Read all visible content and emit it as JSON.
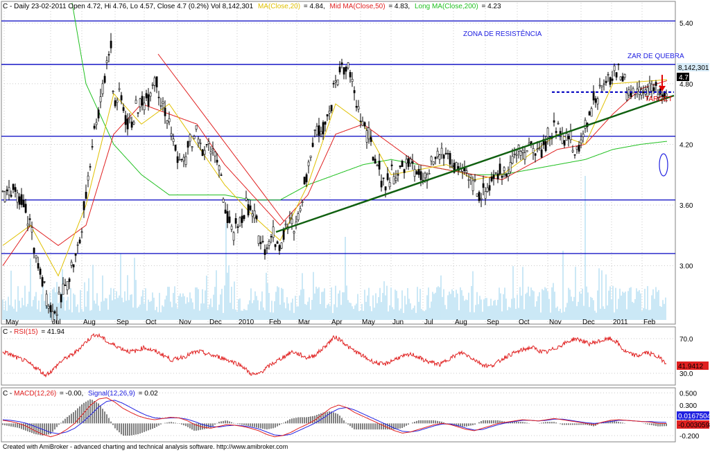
{
  "chart_data": [
    {
      "type": "candlestick",
      "header": {
        "prefix": "C - Daily 23-02-2011 Open 4.72, Hi 4.76, Lo 4.57, Close 4.7 (0.2%) Vol 8,142,301",
        "short_ma": "MA(Close,20)",
        "short_ma_value": "= 4.84,",
        "mid_ma": "Mid MA(Close,50)",
        "mid_ma_value": "= 4.83,",
        "long_ma": "Long MA(Close,200)",
        "long_ma_value": "= 4.23"
      },
      "x_labels": [
        "May",
        "Jul",
        "Aug",
        "Sep",
        "Oct",
        "Nov",
        "Dec",
        "2010",
        "Feb",
        "Mar",
        "Apr",
        "May",
        "Jun",
        "Jul",
        "Aug",
        "Sep",
        "Oct",
        "Nov",
        "Dec",
        "2011",
        "Feb"
      ],
      "y_ticks": [
        3.0,
        3.6,
        4.2,
        4.8,
        5.4
      ],
      "y_tick_labels": [
        "3.00",
        "3.60",
        "4.20",
        "4.80",
        "5.40"
      ],
      "ylim": [
        2.45,
        5.6
      ],
      "horizontal_levels": [
        5.42,
        4.99,
        4.28,
        3.65,
        3.12
      ],
      "price_path": [
        [
          0,
          3.7
        ],
        [
          10,
          3.8
        ],
        [
          20,
          3.65
        ],
        [
          30,
          3.6
        ],
        [
          40,
          3.4
        ],
        [
          50,
          3.0
        ],
        [
          60,
          2.8
        ],
        [
          70,
          2.55
        ],
        [
          80,
          2.6
        ],
        [
          90,
          2.8
        ],
        [
          100,
          3.0
        ],
        [
          110,
          3.2
        ],
        [
          120,
          3.7
        ],
        [
          130,
          4.3
        ],
        [
          140,
          4.6
        ],
        [
          150,
          5.0
        ],
        [
          155,
          5.3
        ],
        [
          160,
          4.6
        ],
        [
          170,
          4.7
        ],
        [
          180,
          4.4
        ],
        [
          190,
          4.5
        ],
        [
          200,
          4.6
        ],
        [
          210,
          4.7
        ],
        [
          220,
          4.9
        ],
        [
          230,
          4.6
        ],
        [
          240,
          4.4
        ],
        [
          250,
          4.1
        ],
        [
          260,
          4.0
        ],
        [
          270,
          4.2
        ],
        [
          280,
          4.3
        ],
        [
          290,
          4.1
        ],
        [
          300,
          4.2
        ],
        [
          310,
          4.0
        ],
        [
          320,
          3.6
        ],
        [
          330,
          3.3
        ],
        [
          340,
          3.4
        ],
        [
          350,
          3.6
        ],
        [
          360,
          3.5
        ],
        [
          370,
          3.3
        ],
        [
          380,
          3.2
        ],
        [
          390,
          3.3
        ],
        [
          400,
          3.2
        ],
        [
          410,
          3.4
        ],
        [
          420,
          3.4
        ],
        [
          430,
          3.6
        ],
        [
          440,
          4.0
        ],
        [
          450,
          4.3
        ],
        [
          460,
          4.4
        ],
        [
          470,
          4.5
        ],
        [
          480,
          4.8
        ],
        [
          490,
          5.0
        ],
        [
          500,
          4.9
        ],
        [
          510,
          4.6
        ],
        [
          520,
          4.4
        ],
        [
          530,
          4.2
        ],
        [
          540,
          4.0
        ],
        [
          550,
          3.8
        ],
        [
          560,
          3.9
        ],
        [
          570,
          3.9
        ],
        [
          580,
          4.0
        ],
        [
          590,
          4.0
        ],
        [
          600,
          3.9
        ],
        [
          610,
          3.8
        ],
        [
          620,
          4.0
        ],
        [
          630,
          4.1
        ],
        [
          640,
          4.1
        ],
        [
          650,
          4.0
        ],
        [
          660,
          3.9
        ],
        [
          670,
          3.9
        ],
        [
          680,
          3.8
        ],
        [
          690,
          3.7
        ],
        [
          700,
          3.8
        ],
        [
          710,
          3.9
        ],
        [
          720,
          3.9
        ],
        [
          730,
          4.0
        ],
        [
          740,
          4.1
        ],
        [
          750,
          4.1
        ],
        [
          760,
          4.2
        ],
        [
          770,
          4.1
        ],
        [
          780,
          4.2
        ],
        [
          790,
          4.3
        ],
        [
          800,
          4.4
        ],
        [
          810,
          4.3
        ],
        [
          820,
          4.2
        ],
        [
          830,
          4.1
        ],
        [
          840,
          4.4
        ],
        [
          850,
          4.6
        ],
        [
          860,
          4.7
        ],
        [
          870,
          4.8
        ],
        [
          880,
          4.9
        ],
        [
          890,
          4.95
        ],
        [
          900,
          4.75
        ],
        [
          910,
          4.72
        ],
        [
          920,
          4.74
        ],
        [
          930,
          4.76
        ],
        [
          940,
          4.73
        ],
        [
          950,
          4.7
        ],
        [
          958,
          4.7
        ]
      ],
      "short_ma_path": [
        [
          0,
          3.2
        ],
        [
          40,
          3.4
        ],
        [
          80,
          2.9
        ],
        [
          120,
          3.6
        ],
        [
          160,
          4.7
        ],
        [
          200,
          4.4
        ],
        [
          240,
          4.6
        ],
        [
          280,
          4.2
        ],
        [
          320,
          3.8
        ],
        [
          360,
          3.5
        ],
        [
          400,
          3.25
        ],
        [
          440,
          3.8
        ],
        [
          480,
          4.6
        ],
        [
          520,
          4.4
        ],
        [
          560,
          3.9
        ],
        [
          600,
          3.95
        ],
        [
          640,
          4.0
        ],
        [
          680,
          3.85
        ],
        [
          720,
          3.9
        ],
        [
          760,
          4.1
        ],
        [
          800,
          4.3
        ],
        [
          840,
          4.2
        ],
        [
          880,
          4.8
        ],
        [
          920,
          4.82
        ],
        [
          958,
          4.84
        ]
      ],
      "mid_ma_path": [
        [
          0,
          3.0
        ],
        [
          40,
          3.4
        ],
        [
          80,
          3.2
        ],
        [
          120,
          3.4
        ],
        [
          160,
          4.3
        ],
        [
          200,
          4.6
        ],
        [
          240,
          4.5
        ],
        [
          280,
          4.4
        ],
        [
          320,
          4.0
        ],
        [
          360,
          3.7
        ],
        [
          400,
          3.4
        ],
        [
          440,
          3.7
        ],
        [
          480,
          4.3
        ],
        [
          520,
          4.4
        ],
        [
          560,
          4.2
        ],
        [
          600,
          4.0
        ],
        [
          640,
          3.95
        ],
        [
          680,
          3.9
        ],
        [
          720,
          3.85
        ],
        [
          760,
          4.0
        ],
        [
          800,
          4.15
        ],
        [
          840,
          4.2
        ],
        [
          880,
          4.5
        ],
        [
          920,
          4.75
        ],
        [
          958,
          4.83
        ]
      ],
      "long_ma_path": [
        [
          100,
          5.6
        ],
        [
          120,
          4.8
        ],
        [
          160,
          4.2
        ],
        [
          200,
          3.9
        ],
        [
          240,
          3.7
        ],
        [
          280,
          3.7
        ],
        [
          320,
          3.7
        ],
        [
          360,
          3.65
        ],
        [
          400,
          3.65
        ],
        [
          440,
          3.8
        ],
        [
          480,
          3.9
        ],
        [
          520,
          4.0
        ],
        [
          560,
          4.05
        ],
        [
          600,
          4.0
        ],
        [
          640,
          3.95
        ],
        [
          680,
          3.9
        ],
        [
          720,
          3.9
        ],
        [
          760,
          3.95
        ],
        [
          800,
          4.0
        ],
        [
          840,
          4.05
        ],
        [
          880,
          4.15
        ],
        [
          920,
          4.2
        ],
        [
          958,
          4.23
        ]
      ],
      "annotations": {
        "resistance": "ZONA DE RESISTÊNCIA",
        "break": "ZAR DE QUEBRA",
        "target": "TARGET",
        "volume": "8,142,301",
        "close": "4.7"
      }
    },
    {
      "type": "line",
      "header": {
        "prefix": "C - ",
        "rsi": "RSI(15)",
        "rsi_value": "= 41.94"
      },
      "y_ticks": [
        30,
        70
      ],
      "y_tick_labels": [
        "30.0",
        "70.0"
      ],
      "ylim": [
        18,
        82
      ],
      "series": [
        {
          "name": "RSI(15)",
          "values": [
            55,
            52,
            48,
            45,
            40,
            35,
            28,
            33,
            42,
            48,
            52,
            60,
            68,
            75,
            72,
            65,
            62,
            58,
            55,
            56,
            60,
            57,
            54,
            50,
            45,
            48,
            50,
            54,
            55,
            52,
            50,
            48,
            45,
            42,
            38,
            30,
            28,
            34,
            40,
            45,
            50,
            55,
            52,
            48,
            50,
            56,
            64,
            72,
            68,
            60,
            55,
            50,
            45,
            42,
            40,
            44,
            48,
            50,
            52,
            48,
            44,
            42,
            40,
            46,
            50,
            54,
            50,
            45,
            40,
            38,
            42,
            48,
            52,
            55,
            58,
            60,
            56,
            54,
            58,
            62,
            66,
            70,
            68,
            64,
            66,
            68,
            70,
            66,
            56,
            52,
            50,
            54,
            52,
            48,
            42
          ]
        }
      ],
      "value_label": "41.9412"
    },
    {
      "type": "line",
      "header": {
        "prefix": "C - ",
        "macd": "MACD(12,26)",
        "macd_value": "= -0.00,",
        "signal": "Signal(12,26,9)",
        "signal_value": "= 0.02"
      },
      "y_ticks": [
        0.5,
        0.3,
        0.1,
        -0.2
      ],
      "y_tick_labels": [
        "0.500",
        "0.300",
        "0.100",
        "-0.200"
      ],
      "ylim": [
        -0.28,
        0.56
      ],
      "series": [
        {
          "name": "MACD(12,26)",
          "values": [
            0.05,
            0.03,
            0.0,
            -0.05,
            -0.12,
            -0.18,
            -0.22,
            -0.18,
            -0.1,
            0.0,
            0.15,
            0.3,
            0.4,
            0.42,
            0.35,
            0.25,
            0.18,
            0.12,
            0.08,
            0.06,
            0.08,
            0.1,
            0.09,
            0.05,
            -0.02,
            -0.06,
            -0.08,
            -0.05,
            -0.02,
            -0.03,
            -0.05,
            -0.08,
            -0.12,
            -0.18,
            -0.22,
            -0.2,
            -0.15,
            -0.08,
            -0.02,
            0.05,
            0.15,
            0.25,
            0.3,
            0.26,
            0.18,
            0.12,
            0.06,
            0.0,
            -0.06,
            -0.12,
            -0.16,
            -0.14,
            -0.1,
            -0.06,
            -0.02,
            0.0,
            -0.02,
            -0.06,
            -0.1,
            -0.12,
            -0.08,
            -0.04,
            0.0,
            0.02,
            0.04,
            0.06,
            0.05,
            0.04,
            0.06,
            0.08,
            0.06,
            0.04,
            0.02,
            0.0,
            -0.02,
            0.02,
            0.05,
            0.06,
            0.05,
            0.04,
            0.03,
            0.02,
            0.0,
            -0.002
          ]
        },
        {
          "name": "Signal(12,26,9)",
          "values": [
            0.06,
            0.05,
            0.03,
            0.0,
            -0.05,
            -0.1,
            -0.15,
            -0.17,
            -0.14,
            -0.08,
            0.02,
            0.14,
            0.27,
            0.36,
            0.38,
            0.33,
            0.26,
            0.19,
            0.13,
            0.09,
            0.08,
            0.09,
            0.09,
            0.07,
            0.03,
            -0.02,
            -0.05,
            -0.06,
            -0.04,
            -0.03,
            -0.04,
            -0.06,
            -0.09,
            -0.14,
            -0.19,
            -0.2,
            -0.18,
            -0.12,
            -0.06,
            0.0,
            0.08,
            0.17,
            0.24,
            0.26,
            0.22,
            0.16,
            0.1,
            0.04,
            -0.02,
            -0.08,
            -0.13,
            -0.14,
            -0.12,
            -0.08,
            -0.04,
            -0.01,
            -0.01,
            -0.04,
            -0.08,
            -0.11,
            -0.1,
            -0.06,
            -0.02,
            0.01,
            0.03,
            0.05,
            0.05,
            0.04,
            0.05,
            0.07,
            0.07,
            0.05,
            0.03,
            0.01,
            0.0,
            0.01,
            0.03,
            0.05,
            0.05,
            0.04,
            0.03,
            0.03,
            0.02,
            0.016
          ]
        }
      ],
      "value_labels": [
        "0.0167504",
        "-0.0030598"
      ]
    }
  ],
  "footer": "Created with AmiBroker - advanced charting and technical analysis software. http://www.amibroker.com",
  "colors": {
    "price": "#000000",
    "short_ma": "#e0c000",
    "mid_ma": "#e02020",
    "long_ma": "#20c020",
    "volume": "#a8d8f0",
    "level": "#0000c0",
    "rsi": "#e02020",
    "macd": "#e02020",
    "signal": "#2020e0",
    "grid": "#c8c8c8"
  }
}
